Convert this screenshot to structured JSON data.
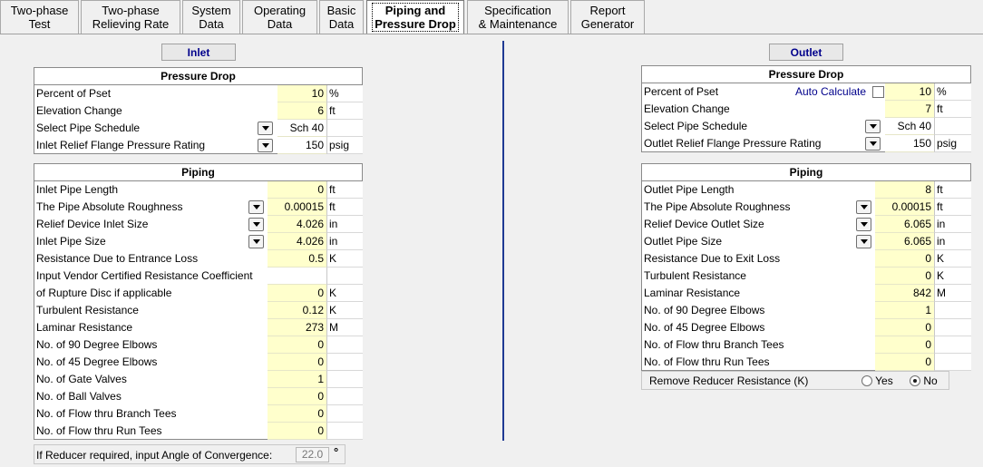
{
  "tabs": [
    {
      "line1": "Two-phase",
      "line2": "Test"
    },
    {
      "line1": "Two-phase",
      "line2": "Relieving Rate"
    },
    {
      "line1": "System",
      "line2": "Data"
    },
    {
      "line1": "Operating",
      "line2": "Data"
    },
    {
      "line1": "Basic",
      "line2": "Data"
    },
    {
      "line1": "Piping and",
      "line2": "Pressure Drop"
    },
    {
      "line1": "Specification",
      "line2": "& Maintenance"
    },
    {
      "line1": "Report",
      "line2": "Generator"
    }
  ],
  "inlet": {
    "title": "Inlet",
    "pressure_drop": {
      "head": "Pressure Drop",
      "rows": [
        {
          "label": "Percent of Pset",
          "value": "10",
          "unit": "%"
        },
        {
          "label": "Elevation Change",
          "value": "6",
          "unit": "ft"
        },
        {
          "label": "Select Pipe Schedule",
          "value": "Sch 40",
          "unit": ""
        },
        {
          "label": "Inlet Relief Flange Pressure Rating",
          "value": "150",
          "unit": "psig"
        }
      ]
    },
    "piping": {
      "head": "Piping",
      "rows": [
        {
          "label": "Inlet Pipe Length",
          "value": "0",
          "unit": "ft"
        },
        {
          "label": "The Pipe Absolute Roughness",
          "value": "0.00015",
          "unit": "ft"
        },
        {
          "label": "Relief Device Inlet Size",
          "value": "4.026",
          "unit": "in"
        },
        {
          "label": "Inlet Pipe Size",
          "value": "4.026",
          "unit": "in"
        },
        {
          "label": "Resistance Due to Entrance Loss",
          "value": "0.5",
          "unit": "K"
        },
        {
          "label": "Input Vendor Certified Resistance Coefficient",
          "value": "",
          "unit": ""
        },
        {
          "label": " of Rupture Disc if applicable",
          "value": "0",
          "unit": "K"
        },
        {
          "label": "Turbulent Resistance",
          "value": "0.12",
          "unit": "K"
        },
        {
          "label": "Laminar Resistance",
          "value": "273",
          "unit": "M"
        },
        {
          "label": "No. of 90 Degree Elbows",
          "value": "0",
          "unit": ""
        },
        {
          "label": "No. of 45 Degree Elbows",
          "value": "0",
          "unit": ""
        },
        {
          "label": "No. of Gate Valves",
          "value": "1",
          "unit": ""
        },
        {
          "label": "No. of Ball Valves",
          "value": "0",
          "unit": ""
        },
        {
          "label": "No. of Flow thru Branch Tees",
          "value": "0",
          "unit": ""
        },
        {
          "label": "No. of Flow thru Run Tees",
          "value": "0",
          "unit": ""
        }
      ]
    },
    "reducer": {
      "label": "If Reducer required, input Angle of Convergence:",
      "value": "22.0",
      "unit": "°"
    }
  },
  "outlet": {
    "title": "Outlet",
    "pressure_drop": {
      "head": "Pressure Drop",
      "auto_calc_label": "Auto Calculate",
      "rows": [
        {
          "label": "Percent of Pset",
          "value": "10",
          "unit": "%"
        },
        {
          "label": "Elevation Change",
          "value": "7",
          "unit": "ft"
        },
        {
          "label": "Select Pipe Schedule",
          "value": "Sch 40",
          "unit": ""
        },
        {
          "label": "Outlet Relief Flange Pressure Rating",
          "value": "150",
          "unit": "psig"
        }
      ]
    },
    "piping": {
      "head": "Piping",
      "rows": [
        {
          "label": "Outlet Pipe Length",
          "value": "8",
          "unit": "ft"
        },
        {
          "label": "The Pipe Absolute Roughness",
          "value": "0.00015",
          "unit": "ft"
        },
        {
          "label": "Relief Device Outlet Size",
          "value": "6.065",
          "unit": "in"
        },
        {
          "label": "Outlet Pipe Size",
          "value": "6.065",
          "unit": "in"
        },
        {
          "label": "Resistance Due to Exit Loss",
          "value": "0",
          "unit": "K"
        },
        {
          "label": "Turbulent Resistance",
          "value": "0",
          "unit": "K"
        },
        {
          "label": "Laminar Resistance",
          "value": "842",
          "unit": "M"
        },
        {
          "label": "No. of 90 Degree Elbows",
          "value": "1",
          "unit": ""
        },
        {
          "label": "No. of 45 Degree Elbows",
          "value": "0",
          "unit": ""
        },
        {
          "label": "No. of Flow thru Branch Tees",
          "value": "0",
          "unit": ""
        },
        {
          "label": "No. of Flow thru Run Tees",
          "value": "0",
          "unit": ""
        }
      ]
    },
    "reducer_resistance": {
      "label": "Remove Reducer Resistance (K)",
      "yes": "Yes",
      "no": "No",
      "selected": "No"
    }
  }
}
